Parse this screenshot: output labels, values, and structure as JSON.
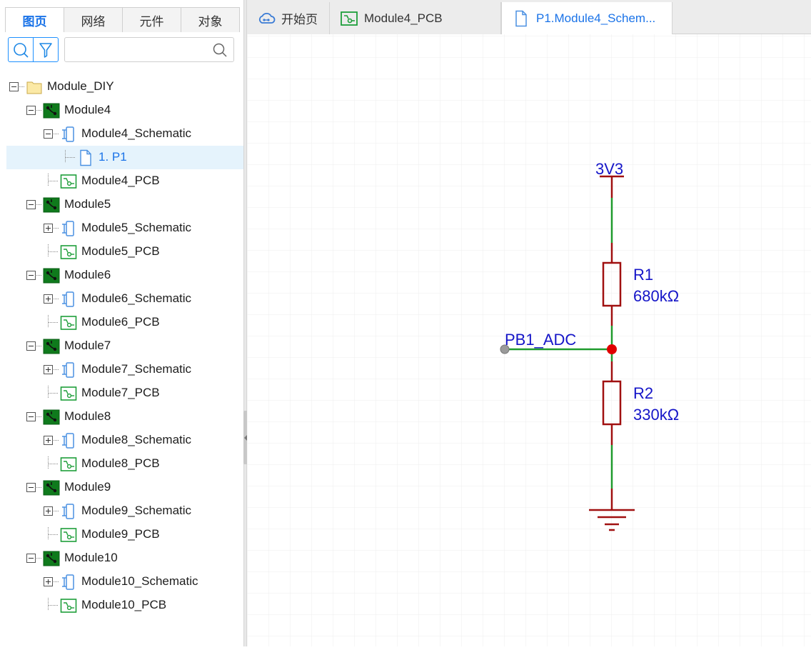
{
  "left_panel": {
    "tabs": [
      "图页",
      "网络",
      "元件",
      "对象"
    ],
    "active_tab": 0,
    "search": {
      "placeholder": "",
      "value": ""
    },
    "tree": [
      {
        "label": "Module_DIY",
        "level": 0,
        "icon": "folder-icon",
        "expander": "minus"
      },
      {
        "label": "Module4",
        "level": 1,
        "icon": "board-icon",
        "expander": "minus"
      },
      {
        "label": "Module4_Schematic",
        "level": 2,
        "icon": "schematic-icon",
        "expander": "minus"
      },
      {
        "label": "1. P1",
        "level": 3,
        "icon": "page-icon",
        "expander": "none",
        "selected": true
      },
      {
        "label": "Module4_PCB",
        "level": 2,
        "icon": "pcb-icon",
        "expander": "none"
      },
      {
        "label": "Module5",
        "level": 1,
        "icon": "board-icon",
        "expander": "minus"
      },
      {
        "label": "Module5_Schematic",
        "level": 2,
        "icon": "schematic-icon",
        "expander": "plus"
      },
      {
        "label": "Module5_PCB",
        "level": 2,
        "icon": "pcb-icon",
        "expander": "none"
      },
      {
        "label": "Module6",
        "level": 1,
        "icon": "board-icon",
        "expander": "minus"
      },
      {
        "label": "Module6_Schematic",
        "level": 2,
        "icon": "schematic-icon",
        "expander": "plus"
      },
      {
        "label": "Module6_PCB",
        "level": 2,
        "icon": "pcb-icon",
        "expander": "none"
      },
      {
        "label": "Module7",
        "level": 1,
        "icon": "board-icon",
        "expander": "minus"
      },
      {
        "label": "Module7_Schematic",
        "level": 2,
        "icon": "schematic-icon",
        "expander": "plus"
      },
      {
        "label": "Module7_PCB",
        "level": 2,
        "icon": "pcb-icon",
        "expander": "none"
      },
      {
        "label": "Module8",
        "level": 1,
        "icon": "board-icon",
        "expander": "minus"
      },
      {
        "label": "Module8_Schematic",
        "level": 2,
        "icon": "schematic-icon",
        "expander": "plus"
      },
      {
        "label": "Module8_PCB",
        "level": 2,
        "icon": "pcb-icon",
        "expander": "none"
      },
      {
        "label": "Module9",
        "level": 1,
        "icon": "board-icon",
        "expander": "minus"
      },
      {
        "label": "Module9_Schematic",
        "level": 2,
        "icon": "schematic-icon",
        "expander": "plus"
      },
      {
        "label": "Module9_PCB",
        "level": 2,
        "icon": "pcb-icon",
        "expander": "none"
      },
      {
        "label": "Module10",
        "level": 1,
        "icon": "board-icon",
        "expander": "minus"
      },
      {
        "label": "Module10_Schematic",
        "level": 2,
        "icon": "schematic-icon",
        "expander": "plus"
      },
      {
        "label": "Module10_PCB",
        "level": 2,
        "icon": "pcb-icon",
        "expander": "none"
      }
    ]
  },
  "doc_tabs": [
    {
      "label": "开始页",
      "icon": "cloud-icon",
      "active": false
    },
    {
      "label": "Module4_PCB",
      "icon": "pcb-icon",
      "active": false
    },
    {
      "label": "P1.Module4_Schem...",
      "icon": "page-icon",
      "active": true
    }
  ],
  "schematic": {
    "power_label": "3V3",
    "net_label": "PB1_ADC",
    "r1": {
      "designator": "R1",
      "value": "680kΩ"
    },
    "r2": {
      "designator": "R2",
      "value": "330kΩ"
    },
    "colors": {
      "wire": "#1f9b2d",
      "pin": "#a01010",
      "text": "#1515c8",
      "junction": "#e00000",
      "grid": "#ececec"
    }
  }
}
